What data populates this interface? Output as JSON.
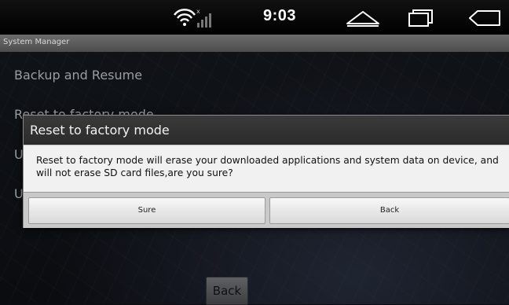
{
  "status_bar": {
    "time": "9:03",
    "icons": [
      "wifi-icon",
      "signal-icon",
      "home-icon",
      "recent-apps-icon",
      "back-nav-icon"
    ]
  },
  "app": {
    "title": "System Manager",
    "menu_items": [
      {
        "label": "Backup and Resume"
      },
      {
        "label": "Reset to factory mode"
      },
      {
        "label": "U"
      },
      {
        "label": "U"
      }
    ],
    "back_button": "Back"
  },
  "dialog": {
    "title": "Reset to factory mode",
    "message": "Reset to factory mode will erase your downloaded applications and system data on device, and will not erase SD card files,are you sure?",
    "confirm_label": "Sure",
    "cancel_label": "Back"
  }
}
